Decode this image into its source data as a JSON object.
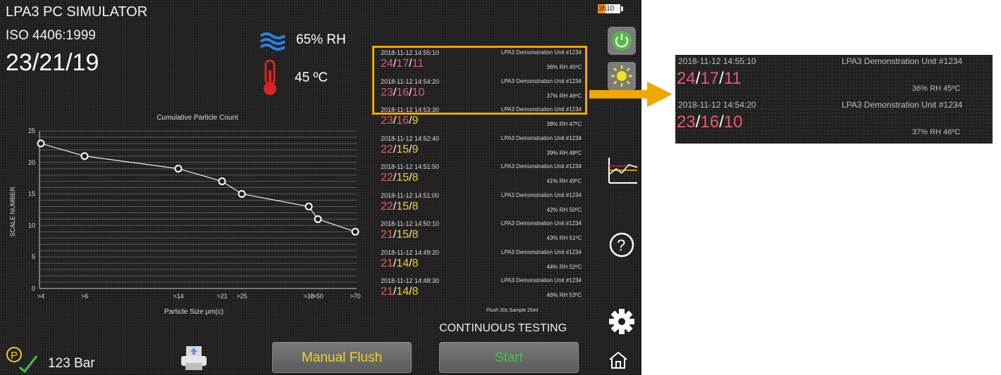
{
  "app": {
    "title": "LPA3 PC SIMULATOR",
    "standard": "ISO 4406:1999",
    "code": "23/21/19"
  },
  "env": {
    "humidity": "65% RH",
    "temperature": "45 ºC"
  },
  "battery": {
    "label": "3h10",
    "level": 0.35
  },
  "chart_data": {
    "type": "line",
    "title": "Cumulative Particle Count",
    "xlabel": "Particle Size µm(c)",
    "ylabel": "SCALE NUMBER",
    "x": [
      ">4",
      ">6",
      ">14",
      ">21",
      ">25",
      ">38",
      ">50",
      ">70"
    ],
    "values": [
      23,
      21,
      19,
      17,
      15,
      13,
      11,
      9
    ],
    "yticks": [
      "0",
      "5",
      "10",
      "15",
      "20",
      "25"
    ],
    "ylim": [
      0,
      25
    ],
    "grid": true
  },
  "records": [
    {
      "ts": "2018-11-12 14:55:10",
      "unit": "LPA3 Demonstration Unit #1234",
      "c1": "24",
      "c2": "17",
      "c3": "11",
      "env": "36% RH  45ºC"
    },
    {
      "ts": "2018-11-12 14:54:20",
      "unit": "LPA3 Demonstration Unit #1234",
      "c1": "23",
      "c2": "16",
      "c3": "10",
      "env": "37% RH  46ºC"
    },
    {
      "ts": "2018-11-12 14:53:30",
      "unit": "LPA3 Demonstration Unit #1234",
      "c1": "23",
      "c2": "16",
      "c3": "9",
      "env": "38% RH  47ºC"
    },
    {
      "ts": "2018-11-12 14:52:40",
      "unit": "LPA3 Demonstration Unit #1234",
      "c1": "22",
      "c2": "15",
      "c3": "9",
      "env": "39% RH  48ºC"
    },
    {
      "ts": "2018-11-12 14:51:50",
      "unit": "LPA3 Demonstration Unit #1234",
      "c1": "22",
      "c2": "15",
      "c3": "8",
      "env": "41% RH  49ºC"
    },
    {
      "ts": "2018-11-12 14:51:00",
      "unit": "LPA3 Demonstration Unit #1234",
      "c1": "22",
      "c2": "15",
      "c3": "8",
      "env": "42% RH  50ºC"
    },
    {
      "ts": "2018-11-12 14:50:10",
      "unit": "LPA3 Demonstration Unit #1234",
      "c1": "21",
      "c2": "15",
      "c3": "8",
      "env": "43% RH  51ºC"
    },
    {
      "ts": "2018-11-12 14:49:20",
      "unit": "LPA3 Demonstration Unit #1234",
      "c1": "21",
      "c2": "14",
      "c3": "8",
      "env": "44% RH  52ºC"
    },
    {
      "ts": "2018-11-12 14:48:30",
      "unit": "LPA3 Demonstration Unit #1234",
      "c1": "21",
      "c2": "14",
      "c3": "8",
      "env": "46% RH  53ºC"
    }
  ],
  "footer": {
    "flush_info": "Flush 30s Sample 25ml",
    "mode": "CONTINUOUS TESTING",
    "manual_flush": "Manual Flush",
    "start": "Start",
    "pressure": "123 Bar"
  },
  "icons": {
    "humidity": "humidity-waves-icon",
    "temperature": "thermometer-icon",
    "power": "power-icon",
    "brightness": "sun-icon",
    "trend": "trend-chart-icon",
    "help": "help-icon",
    "settings": "gear-icon",
    "home": "home-icon",
    "print": "printer-icon",
    "pressure": "pressure-check-icon"
  },
  "colors": {
    "accent": "#f0a800",
    "code_red": "#e85a6a",
    "code_yellow": "#f5d020",
    "start_green": "#43c24a",
    "flush_yellow": "#e8d52a"
  }
}
